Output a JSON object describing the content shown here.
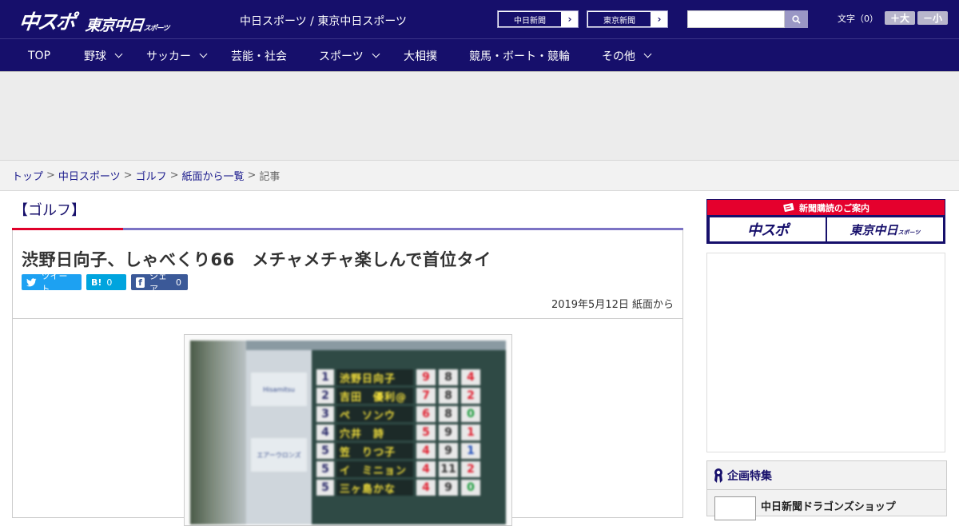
{
  "header": {
    "logo_main": "中スポ",
    "logo_sub": "東京中日",
    "logo_sub_small": "スポーツ",
    "site_name": "中日スポーツ / 東京中日スポーツ",
    "paper_buttons": [
      {
        "label": "中日新聞"
      },
      {
        "label": "東京新聞"
      }
    ],
    "search": {
      "placeholder": ""
    },
    "font_size": {
      "label": "文字（0）",
      "bigger": "＋大",
      "smaller": "－小"
    }
  },
  "nav": {
    "items": [
      {
        "label": "TOP",
        "dropdown": false
      },
      {
        "label": "野球",
        "dropdown": true
      },
      {
        "label": "サッカー",
        "dropdown": true
      },
      {
        "label": "芸能・社会",
        "dropdown": false
      },
      {
        "label": "スポーツ",
        "dropdown": true
      },
      {
        "label": "大相撲",
        "dropdown": false
      },
      {
        "label": "競馬・ボート・競輪",
        "dropdown": false
      },
      {
        "label": "その他",
        "dropdown": true
      }
    ]
  },
  "breadcrumb": {
    "items": [
      "トップ",
      "中日スポーツ",
      "ゴルフ",
      "紙面から一覧"
    ],
    "current": "記事",
    "separator": ">"
  },
  "article": {
    "category": "【ゴルフ】",
    "headline": "渋野日向子、しゃべくり66　メチャメチャ楽しんで首位タイ",
    "share": {
      "tweet": "ツイート",
      "hatena_icon": "B!",
      "hatena_count": "0",
      "facebook_icon": "f",
      "facebook_label": "シェア",
      "facebook_count": "0"
    },
    "date": "2019年5月12日 紙面から",
    "photo": {
      "sponsor_1": "Hisamitsu",
      "sponsor_2": "エアーウロンズ",
      "leaderboard": [
        {
          "rank": "1",
          "name": "渋野日向子",
          "scores": [
            "9",
            "8",
            "4"
          ]
        },
        {
          "rank": "2",
          "name": "吉田　優利@",
          "scores": [
            "7",
            "8",
            "2"
          ]
        },
        {
          "rank": "3",
          "name": "ペ　ソンウ",
          "scores": [
            "6",
            "8",
            "0"
          ]
        },
        {
          "rank": "4",
          "name": "穴井　詩",
          "scores": [
            "5",
            "9",
            "1"
          ]
        },
        {
          "rank": "5",
          "name": "笠　りつ子",
          "scores": [
            "4",
            "9",
            "1"
          ]
        },
        {
          "rank": "5",
          "name": "イ　ミニョン",
          "scores": [
            "4",
            "11",
            "2"
          ]
        },
        {
          "rank": "5",
          "name": "三ヶ島かな",
          "scores": [
            "4",
            "9",
            "0"
          ]
        }
      ]
    }
  },
  "sidebar": {
    "subscribe_heading": "新聞購読のご案内",
    "subscribe_1": "中スポ",
    "subscribe_2": "東京中日",
    "subscribe_2_small": "スポーツ",
    "feature_heading": "企画特集",
    "feature_item": "中日新聞ドラゴンズショップ"
  }
}
